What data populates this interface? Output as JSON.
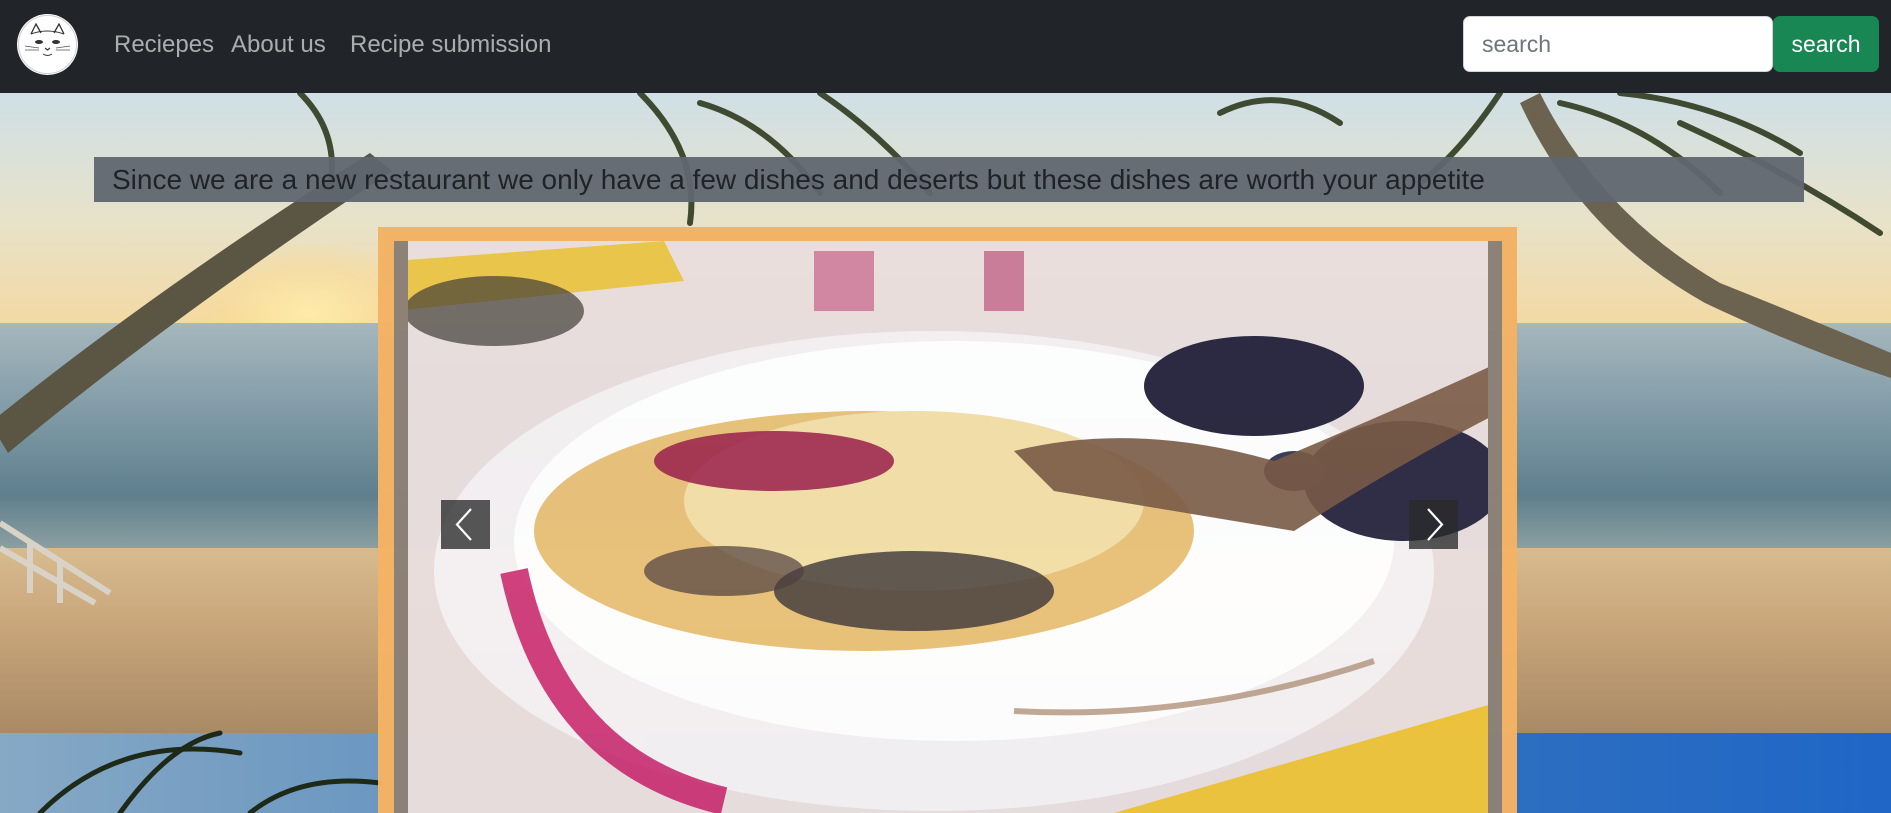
{
  "navbar": {
    "logo_icon": "cat-face-logo",
    "links": [
      {
        "label": "Reciepes"
      },
      {
        "label": "About us"
      },
      {
        "label": "Recipe submission"
      }
    ],
    "search": {
      "placeholder": "search",
      "value": "",
      "button_label": "search"
    }
  },
  "message": {
    "text": "Since we are a new restaurant we only have a few dishes and deserts but these dishes are worth your appetite"
  },
  "carousel": {
    "prev_icon": "chevron-left-icon",
    "next_icon": "chevron-right-icon",
    "slide_image": "blueberry-cobbler-dessert-photo"
  },
  "colors": {
    "navbar_bg": "#212529",
    "search_button": "#198754",
    "carousel_frame": "#f4b365",
    "message_bg": "#606670"
  }
}
